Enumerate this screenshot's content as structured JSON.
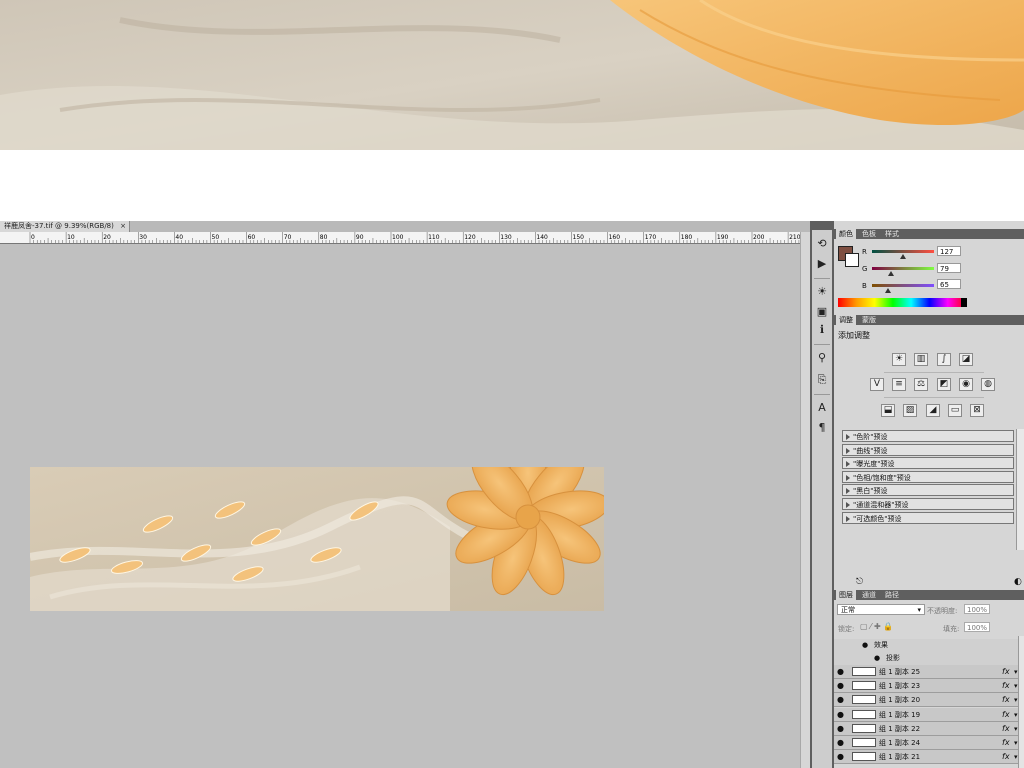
{
  "document": {
    "tab_title": "祥鹿凤舍-37.tif @ 9.39%(RGB/8)",
    "close_glyph": "×",
    "ruler_numbers": [
      "0",
      "10",
      "20",
      "30",
      "40",
      "50",
      "60",
      "70",
      "80",
      "90",
      "100",
      "110",
      "120",
      "130",
      "140",
      "150",
      "160",
      "170",
      "180",
      "190",
      "200",
      "210"
    ]
  },
  "tools": [
    {
      "icon": "history-brush-icon",
      "glyph": "⟲"
    },
    {
      "icon": "play-icon",
      "glyph": "▶"
    },
    {
      "icon": "brightness-icon",
      "glyph": "☀"
    },
    {
      "icon": "image-icon",
      "glyph": "▣"
    },
    {
      "icon": "info-icon",
      "glyph": "ℹ"
    },
    {
      "icon": "clone-source-icon",
      "glyph": "⚲"
    },
    {
      "icon": "stamp-icon",
      "glyph": "⎘"
    },
    {
      "icon": "character-icon",
      "glyph": "A"
    },
    {
      "icon": "paragraph-icon",
      "glyph": "¶"
    }
  ],
  "color_panel": {
    "tabs": [
      "颜色",
      "色板",
      "样式"
    ],
    "channels": [
      {
        "label": "R",
        "value": "127",
        "fraction": 0.498
      },
      {
        "label": "G",
        "value": "79",
        "fraction": 0.31
      },
      {
        "label": "B",
        "value": "65",
        "fraction": 0.255
      }
    ],
    "foreground": "#7f4f41",
    "background": "#ffffff"
  },
  "adjust_panel": {
    "tabs": [
      "调整",
      "蒙版"
    ],
    "title": "添加调整",
    "icons_row1": [
      "brightness-contrast-icon",
      "levels-icon",
      "curves-icon",
      "exposure-icon"
    ],
    "icons_row2": [
      "vibrance-icon",
      "hue-saturation-icon",
      "color-balance-icon",
      "black-white-icon",
      "photo-filter-icon",
      "channel-mixer-icon"
    ],
    "icons_row3": [
      "invert-icon",
      "posterize-icon",
      "threshold-icon",
      "gradient-map-icon",
      "selective-color-icon"
    ],
    "presets": [
      "\"色阶\"预设",
      "\"曲线\"预设",
      "\"曝光度\"预设",
      "\"色相/饱和度\"预设",
      "\"黑白\"预设",
      "\"通道混和器\"预设",
      "\"可选颜色\"预设"
    ]
  },
  "layers_panel": {
    "tabs": [
      "图层",
      "通道",
      "路径"
    ],
    "blend_mode": "正常",
    "opacity_label": "不透明度:",
    "opacity_value": "100%",
    "lock_label": "锁定:",
    "fill_label": "填充:",
    "fill_value": "100%",
    "effects_label": "效果",
    "drop_shadow_label": "投影",
    "fx_label": "fx",
    "layers": [
      "组 1 副本 25",
      "组 1 副本 23",
      "组 1 副本 20",
      "组 1 副本 19",
      "组 1 副本 22",
      "组 1 副本 24",
      "组 1 副本 21"
    ]
  },
  "colors": {
    "canvas_bg": "#c0c0c0",
    "panel_bg": "#d6d6d6",
    "dark_chrome": "#5f5f5f",
    "flower": "#f0b15e",
    "wall": "#d8ccba"
  }
}
